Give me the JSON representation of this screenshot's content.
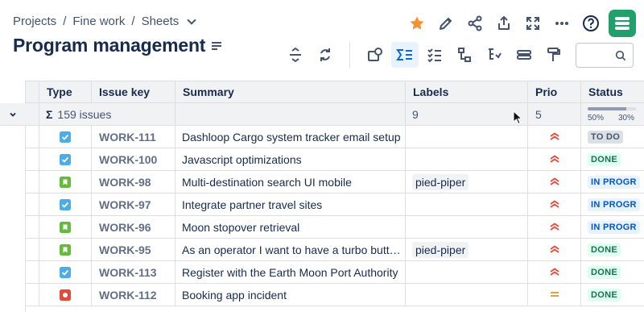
{
  "breadcrumb": {
    "items": [
      "Projects",
      "Fine work",
      "Sheets"
    ],
    "separator": "/"
  },
  "page_title": "Program management",
  "colors": {
    "star": "#f79232",
    "logo": "#22a06b",
    "accent": "#0c66e4"
  },
  "columns": [
    "Type",
    "Issue key",
    "Summary",
    "Labels",
    "Prio",
    "Status"
  ],
  "group": {
    "sigma": "Σ",
    "count": "159 issues",
    "labels_count": "9",
    "prio_count": "5",
    "pct_a": "50%",
    "pct_b": "30%",
    "progress": 0.8
  },
  "rows": [
    {
      "type": "task",
      "key": "WORK-111",
      "summary": "Dashloop Cargo system tracker email setup",
      "label": "",
      "prio": "high",
      "status": "TO DO",
      "status_kind": "todo"
    },
    {
      "type": "task",
      "key": "WORK-100",
      "summary": "Javascript optimizations",
      "label": "",
      "prio": "high",
      "status": "DONE",
      "status_kind": "done"
    },
    {
      "type": "story",
      "key": "WORK-98",
      "summary": "Multi-destination search UI mobile",
      "label": "pied-piper",
      "prio": "high",
      "status": "IN PROGR",
      "status_kind": "prog"
    },
    {
      "type": "task",
      "key": "WORK-97",
      "summary": "Integrate partner travel sites",
      "label": "",
      "prio": "high",
      "status": "IN PROGR",
      "status_kind": "prog"
    },
    {
      "type": "story",
      "key": "WORK-96",
      "summary": "Moon stopover retrieval",
      "label": "",
      "prio": "high",
      "status": "IN PROGR",
      "status_kind": "prog"
    },
    {
      "type": "story",
      "key": "WORK-95",
      "summary": "As an operator I want to have a turbo butt…",
      "label": "pied-piper",
      "prio": "high",
      "status": "DONE",
      "status_kind": "done"
    },
    {
      "type": "task",
      "key": "WORK-113",
      "summary": "Register with the Earth Moon Port Authority",
      "label": "",
      "prio": "high",
      "status": "DONE",
      "status_kind": "done"
    },
    {
      "type": "bug",
      "key": "WORK-112",
      "summary": "Booking app incident",
      "label": "",
      "prio": "medium",
      "status": "DONE",
      "status_kind": "done"
    }
  ]
}
